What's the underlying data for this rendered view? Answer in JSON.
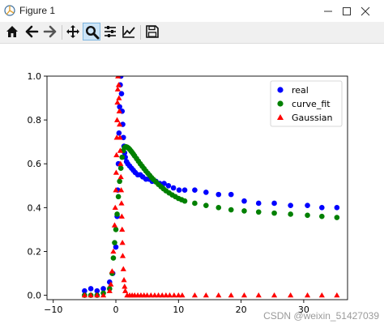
{
  "window": {
    "title": "Figure 1",
    "app_icon": "matplotlib-figure-icon",
    "controls": [
      "minimize-icon",
      "maximize-icon",
      "close-icon"
    ]
  },
  "toolbar": {
    "buttons": [
      {
        "icon": "home-icon",
        "active": false
      },
      {
        "icon": "back-arrow-icon",
        "active": false
      },
      {
        "icon": "forward-arrow-icon",
        "active": false
      },
      {
        "icon": "pan-move-icon",
        "active": false
      },
      {
        "icon": "zoom-magnifier-icon",
        "active": true
      },
      {
        "icon": "subplots-configure-icon",
        "active": false
      },
      {
        "icon": "edit-axis-line-icon",
        "active": false
      },
      {
        "icon": "save-floppy-icon",
        "active": false
      }
    ]
  },
  "chart_data": {
    "type": "scatter",
    "title": "",
    "xlabel": "",
    "ylabel": "",
    "xlim": [
      -11,
      37
    ],
    "ylim": [
      -0.02,
      1.0
    ],
    "x_ticks": [
      -10,
      0,
      10,
      20,
      30
    ],
    "y_ticks": [
      0.0,
      0.2,
      0.4,
      0.6,
      0.8,
      1.0
    ],
    "x_tick_labels": [
      "−10",
      "0",
      "10",
      "20",
      "30"
    ],
    "y_tick_labels": [
      "0.0",
      "0.2",
      "0.4",
      "0.6",
      "0.8",
      "1.0"
    ],
    "legend_position": "top-right",
    "grid": false,
    "series": [
      {
        "name": "real",
        "marker": "circle",
        "color": "#0000ff",
        "points": [
          [
            -5.0,
            0.02
          ],
          [
            -4.0,
            0.03
          ],
          [
            -3.0,
            0.02
          ],
          [
            -2.0,
            0.03
          ],
          [
            -1.0,
            0.06
          ],
          [
            -0.5,
            0.1
          ],
          [
            0.0,
            0.22
          ],
          [
            0.2,
            0.36
          ],
          [
            0.3,
            0.48
          ],
          [
            0.4,
            0.6
          ],
          [
            0.5,
            0.74
          ],
          [
            0.6,
            0.86
          ],
          [
            0.7,
            0.96
          ],
          [
            0.8,
            1.0
          ],
          [
            0.9,
            0.92
          ],
          [
            1.0,
            0.84
          ],
          [
            1.1,
            0.78
          ],
          [
            1.2,
            0.72
          ],
          [
            1.3,
            0.68
          ],
          [
            1.4,
            0.65
          ],
          [
            1.5,
            0.63
          ],
          [
            1.7,
            0.61
          ],
          [
            1.9,
            0.6
          ],
          [
            2.2,
            0.59
          ],
          [
            2.5,
            0.58
          ],
          [
            2.8,
            0.57
          ],
          [
            3.1,
            0.56
          ],
          [
            3.5,
            0.55
          ],
          [
            3.9,
            0.55
          ],
          [
            4.3,
            0.54
          ],
          [
            4.8,
            0.53
          ],
          [
            5.3,
            0.53
          ],
          [
            5.8,
            0.52
          ],
          [
            6.4,
            0.52
          ],
          [
            7.0,
            0.51
          ],
          [
            7.7,
            0.51
          ],
          [
            8.4,
            0.5
          ],
          [
            9.2,
            0.49
          ],
          [
            10.1,
            0.48
          ],
          [
            11.0,
            0.48
          ],
          [
            12.6,
            0.48
          ],
          [
            14.4,
            0.47
          ],
          [
            16.4,
            0.46
          ],
          [
            18.4,
            0.46
          ],
          [
            20.5,
            0.43
          ],
          [
            22.8,
            0.42
          ],
          [
            25.3,
            0.42
          ],
          [
            27.9,
            0.41
          ],
          [
            30.6,
            0.41
          ],
          [
            32.9,
            0.4
          ],
          [
            35.3,
            0.4
          ]
        ]
      },
      {
        "name": "curve_fit",
        "marker": "circle",
        "color": "#008000",
        "points": [
          [
            -5.0,
            0.0
          ],
          [
            -4.0,
            0.0
          ],
          [
            -3.0,
            0.0
          ],
          [
            -2.0,
            0.01
          ],
          [
            -1.0,
            0.03
          ],
          [
            -0.6,
            0.1
          ],
          [
            -0.4,
            0.17
          ],
          [
            -0.2,
            0.24
          ],
          [
            0.0,
            0.3
          ],
          [
            0.2,
            0.37
          ],
          [
            0.4,
            0.45
          ],
          [
            0.6,
            0.52
          ],
          [
            0.8,
            0.58
          ],
          [
            1.0,
            0.63
          ],
          [
            1.2,
            0.66
          ],
          [
            1.4,
            0.675
          ],
          [
            1.6,
            0.678
          ],
          [
            1.8,
            0.676
          ],
          [
            2.0,
            0.672
          ],
          [
            2.2,
            0.666
          ],
          [
            2.4,
            0.659
          ],
          [
            2.6,
            0.652
          ],
          [
            2.8,
            0.644
          ],
          [
            3.0,
            0.636
          ],
          [
            3.3,
            0.624
          ],
          [
            3.6,
            0.612
          ],
          [
            3.9,
            0.6
          ],
          [
            4.2,
            0.589
          ],
          [
            4.5,
            0.578
          ],
          [
            4.8,
            0.567
          ],
          [
            5.1,
            0.557
          ],
          [
            5.4,
            0.547
          ],
          [
            5.7,
            0.537
          ],
          [
            6.0,
            0.528
          ],
          [
            6.4,
            0.517
          ],
          [
            6.8,
            0.506
          ],
          [
            7.2,
            0.496
          ],
          [
            7.6,
            0.486
          ],
          [
            8.0,
            0.477
          ],
          [
            8.5,
            0.467
          ],
          [
            9.0,
            0.458
          ],
          [
            9.5,
            0.45
          ],
          [
            10.0,
            0.442
          ],
          [
            10.5,
            0.436
          ],
          [
            11.0,
            0.43
          ],
          [
            12.6,
            0.42
          ],
          [
            14.4,
            0.41
          ],
          [
            16.4,
            0.4
          ],
          [
            18.4,
            0.39
          ],
          [
            20.5,
            0.385
          ],
          [
            22.8,
            0.38
          ],
          [
            25.3,
            0.375
          ],
          [
            27.9,
            0.37
          ],
          [
            30.6,
            0.365
          ],
          [
            32.9,
            0.36
          ],
          [
            35.3,
            0.355
          ]
        ]
      },
      {
        "name": "Gaussian",
        "marker": "triangle",
        "color": "#ff0000",
        "points": [
          [
            -5.0,
            0.0
          ],
          [
            -4.0,
            0.0
          ],
          [
            -3.0,
            0.0
          ],
          [
            -2.0,
            0.0
          ],
          [
            -1.0,
            0.02
          ],
          [
            -0.8,
            0.05
          ],
          [
            -0.6,
            0.11
          ],
          [
            -0.4,
            0.2
          ],
          [
            -0.2,
            0.32
          ],
          [
            -0.1,
            0.4
          ],
          [
            0.0,
            0.48
          ],
          [
            0.05,
            0.56
          ],
          [
            0.1,
            0.64
          ],
          [
            0.15,
            0.72
          ],
          [
            0.2,
            0.8
          ],
          [
            0.25,
            0.88
          ],
          [
            0.3,
            0.94
          ],
          [
            0.35,
            1.0
          ],
          [
            0.45,
            0.96
          ],
          [
            0.5,
            0.9
          ],
          [
            0.55,
            0.84
          ],
          [
            0.6,
            0.78
          ],
          [
            0.65,
            0.72
          ],
          [
            0.7,
            0.66
          ],
          [
            0.75,
            0.6
          ],
          [
            0.8,
            0.54
          ],
          [
            0.85,
            0.48
          ],
          [
            0.9,
            0.42
          ],
          [
            0.95,
            0.36
          ],
          [
            1.0,
            0.3
          ],
          [
            1.05,
            0.24
          ],
          [
            1.1,
            0.18
          ],
          [
            1.2,
            0.12
          ],
          [
            1.3,
            0.07
          ],
          [
            1.4,
            0.04
          ],
          [
            1.5,
            0.02
          ],
          [
            1.8,
            0.0
          ],
          [
            2.2,
            0.0
          ],
          [
            2.6,
            0.0
          ],
          [
            3.0,
            0.0
          ],
          [
            3.5,
            0.0
          ],
          [
            4.0,
            0.0
          ],
          [
            4.5,
            0.0
          ],
          [
            5.0,
            0.0
          ],
          [
            5.6,
            0.0
          ],
          [
            6.2,
            0.0
          ],
          [
            6.8,
            0.0
          ],
          [
            7.4,
            0.0
          ],
          [
            8.0,
            0.0
          ],
          [
            8.6,
            0.0
          ],
          [
            9.3,
            0.0
          ],
          [
            10.0,
            0.0
          ],
          [
            10.6,
            0.0
          ],
          [
            12.6,
            0.0
          ],
          [
            14.4,
            0.0
          ],
          [
            16.4,
            0.0
          ],
          [
            18.4,
            0.0
          ],
          [
            20.5,
            0.0
          ],
          [
            22.8,
            0.0
          ],
          [
            25.3,
            0.0
          ],
          [
            27.9,
            0.0
          ],
          [
            30.6,
            0.0
          ],
          [
            32.9,
            0.0
          ],
          [
            35.3,
            0.0
          ]
        ]
      }
    ]
  },
  "watermark": "CSDN @weixin_51427039"
}
